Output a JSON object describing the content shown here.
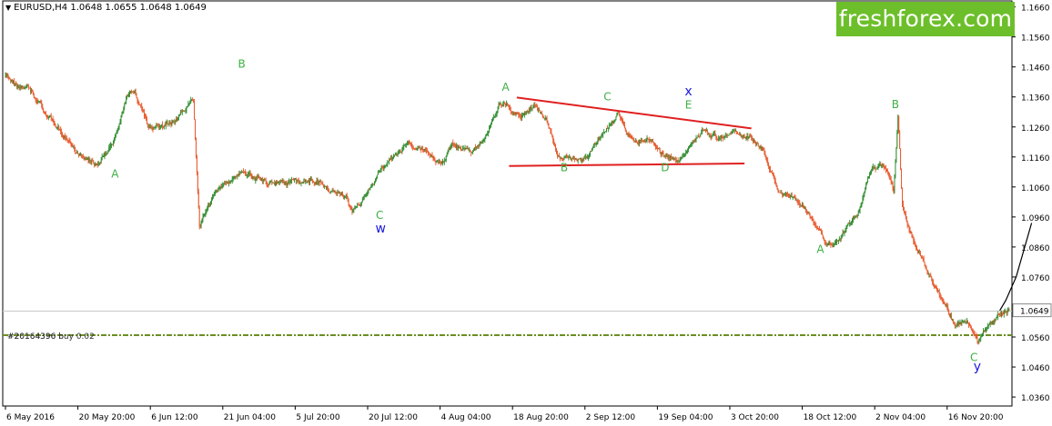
{
  "header": {
    "menu_arrow": "▼",
    "title": "EURUSD,H4  1.0648 1.0655 1.0648 1.0649"
  },
  "logo": {
    "text": "freshforex.com"
  },
  "order": {
    "label_a": "#20164396 b",
    "label_b": "#20164396 buy 0.02"
  },
  "colors": {
    "background": "#ffffff",
    "bull_candle": "#2e8b2e",
    "bear_candle": "#e8572a",
    "wave_green": "#3cb043",
    "wave_blue": "#1a1adb",
    "trendline": "#e02020",
    "forecast": "#000000",
    "logo_bg": "#6cbf2a",
    "price_line": "#c8c8c8",
    "order_line": "#6b8e23"
  },
  "chart_data": {
    "type": "candlestick",
    "symbol": "EURUSD",
    "timeframe": "H4",
    "ohlc_last": {
      "open": 1.0648,
      "high": 1.0655,
      "low": 1.0648,
      "close": 1.0649
    },
    "ylim": [
      1.033,
      1.168
    ],
    "y_ticks": [
      "1.1660",
      "1.1560",
      "1.1460",
      "1.1360",
      "1.1260",
      "1.1160",
      "1.1060",
      "1.0960",
      "1.0860",
      "1.0760",
      "1.0560",
      "1.0460",
      "1.0360"
    ],
    "current_price": "1.0649",
    "x_labels": [
      "6 May 2016",
      "20 May 20:00",
      "6 Jun 12:00",
      "21 Jun 04:00",
      "5 Jul 20:00",
      "20 Jul 12:00",
      "4 Aug 04:00",
      "18 Aug 20:00",
      "2 Sep 12:00",
      "19 Sep 04:00",
      "3 Oct 20:00",
      "18 Oct 12:00",
      "2 Nov 04:00",
      "16 Nov 20:00"
    ],
    "x_label_index": [
      0,
      84,
      168,
      252,
      336,
      420,
      504,
      588,
      672,
      756,
      840,
      924,
      1008,
      1092
    ],
    "bar_count": 1165,
    "anchors": [
      [
        0,
        1.143
      ],
      [
        25,
        1.139
      ],
      [
        50,
        1.13
      ],
      [
        85,
        1.117
      ],
      [
        105,
        1.114
      ],
      [
        125,
        1.12
      ],
      [
        140,
        1.136
      ],
      [
        150,
        1.138
      ],
      [
        165,
        1.126
      ],
      [
        185,
        1.126
      ],
      [
        200,
        1.129
      ],
      [
        218,
        1.135
      ],
      [
        225,
        1.093
      ],
      [
        245,
        1.105
      ],
      [
        275,
        1.111
      ],
      [
        310,
        1.107
      ],
      [
        340,
        1.107
      ],
      [
        365,
        1.108
      ],
      [
        378,
        1.104
      ],
      [
        395,
        1.103
      ],
      [
        402,
        1.098
      ],
      [
        420,
        1.104
      ],
      [
        445,
        1.115
      ],
      [
        470,
        1.12
      ],
      [
        488,
        1.118
      ],
      [
        505,
        1.115
      ],
      [
        520,
        1.12
      ],
      [
        540,
        1.118
      ],
      [
        560,
        1.125
      ],
      [
        572,
        1.134
      ],
      [
        582,
        1.133
      ],
      [
        598,
        1.131
      ],
      [
        615,
        1.133
      ],
      [
        628,
        1.128
      ],
      [
        640,
        1.116
      ],
      [
        656,
        1.115
      ],
      [
        675,
        1.116
      ],
      [
        695,
        1.124
      ],
      [
        710,
        1.13
      ],
      [
        725,
        1.122
      ],
      [
        745,
        1.123
      ],
      [
        760,
        1.118
      ],
      [
        780,
        1.115
      ],
      [
        795,
        1.122
      ],
      [
        810,
        1.125
      ],
      [
        825,
        1.122
      ],
      [
        845,
        1.123
      ],
      [
        865,
        1.122
      ],
      [
        880,
        1.118
      ],
      [
        895,
        1.106
      ],
      [
        915,
        1.102
      ],
      [
        935,
        1.096
      ],
      [
        950,
        1.088
      ],
      [
        962,
        1.087
      ],
      [
        975,
        1.092
      ],
      [
        990,
        1.098
      ],
      [
        1005,
        1.113
      ],
      [
        1020,
        1.112
      ],
      [
        1030,
        1.105
      ],
      [
        1035,
        1.129
      ],
      [
        1040,
        1.1
      ],
      [
        1055,
        1.086
      ],
      [
        1070,
        1.078
      ],
      [
        1085,
        1.07
      ],
      [
        1100,
        1.06
      ],
      [
        1115,
        1.061
      ],
      [
        1128,
        1.053
      ],
      [
        1140,
        1.06
      ],
      [
        1152,
        1.064
      ],
      [
        1164,
        1.0649
      ]
    ],
    "wave_labels": [
      {
        "text": "B",
        "i": 274,
        "price": 1.1458,
        "series": "green"
      },
      {
        "text": "A",
        "i": 127,
        "price": 1.1092,
        "series": "green"
      },
      {
        "text": "C",
        "i": 434,
        "price": 1.0954,
        "series": "green"
      },
      {
        "text": "w",
        "i": 435,
        "price": 1.0908,
        "series": "blue"
      },
      {
        "text": "A",
        "i": 580,
        "price": 1.138,
        "series": "green"
      },
      {
        "text": "C",
        "i": 698,
        "price": 1.1348,
        "series": "green"
      },
      {
        "text": "x",
        "i": 792,
        "price": 1.1365,
        "series": "blue"
      },
      {
        "text": "E",
        "i": 792,
        "price": 1.1322,
        "series": "green"
      },
      {
        "text": "B",
        "i": 648,
        "price": 1.1113,
        "series": "green"
      },
      {
        "text": "D",
        "i": 765,
        "price": 1.1113,
        "series": "green"
      },
      {
        "text": "A",
        "i": 945,
        "price": 1.084,
        "series": "green"
      },
      {
        "text": "B",
        "i": 1032,
        "price": 1.1323,
        "series": "green"
      },
      {
        "text": "C",
        "i": 1123,
        "price": 1.048,
        "series": "green"
      },
      {
        "text": "y",
        "i": 1127,
        "price": 1.0448,
        "series": "blue"
      }
    ],
    "trendlines": [
      {
        "from": [
          593,
          1.1358
        ],
        "to": [
          865,
          1.1255
        ]
      },
      {
        "from": [
          584,
          1.113
        ],
        "to": [
          857,
          1.1138
        ]
      }
    ],
    "forecast": [
      [
        1153,
        1.0648
      ],
      [
        1160,
        1.0682
      ],
      [
        1172,
        1.076
      ],
      [
        1190,
        1.094
      ]
    ],
    "horizontal_lines": [
      {
        "kind": "current_price",
        "price": 1.0649
      },
      {
        "kind": "order",
        "price": 1.0568
      },
      {
        "kind": "order",
        "price": 1.0565
      }
    ]
  }
}
